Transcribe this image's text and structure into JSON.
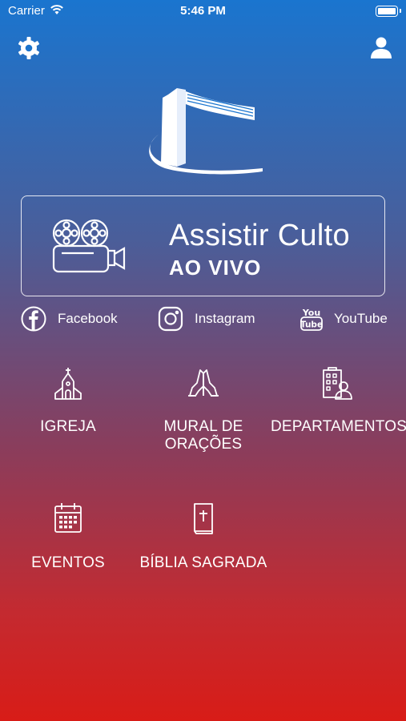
{
  "status_bar": {
    "carrier": "Carrier",
    "time": "5:46 PM"
  },
  "header": {
    "settings_icon": "gear-icon",
    "profile_icon": "user-icon"
  },
  "live": {
    "title": "Assistir Culto",
    "subtitle": "AO VIVO",
    "icon": "film-camera-icon"
  },
  "social": [
    {
      "label": "Facebook",
      "icon": "facebook-icon"
    },
    {
      "label": "Instagram",
      "icon": "instagram-icon"
    },
    {
      "label": "YouTube",
      "icon": "youtube-icon"
    }
  ],
  "menu": [
    {
      "label": "IGREJA",
      "icon": "church-icon"
    },
    {
      "label_line1": "MURAL DE",
      "label_line2": "ORAÇÕES",
      "icon": "praying-hands-icon"
    },
    {
      "label": "DEPARTAMENTOS",
      "icon": "departments-icon"
    },
    {
      "label": "EVENTOS",
      "icon": "calendar-icon"
    },
    {
      "label": "BÍBLIA SAGRADA",
      "icon": "bible-icon"
    }
  ],
  "colors": {
    "top": "#1a75cf",
    "bottom": "#d81c17",
    "foreground": "#ffffff"
  }
}
